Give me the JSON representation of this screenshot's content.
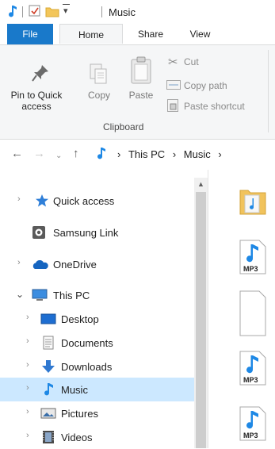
{
  "window": {
    "title": "Music"
  },
  "tabs": {
    "file": "File",
    "home": "Home",
    "share": "Share",
    "view": "View"
  },
  "ribbon": {
    "pin_label_1": "Pin to Quick",
    "pin_label_2": "access",
    "copy_label": "Copy",
    "paste_label": "Paste",
    "cut_label": "Cut",
    "copy_path_label": "Copy path",
    "paste_shortcut_label": "Paste shortcut",
    "group_label": "Clipboard"
  },
  "address": {
    "crumb_sep": "›",
    "crumbs": [
      "This PC",
      "Music"
    ]
  },
  "nav": {
    "items": [
      {
        "label": "Quick access",
        "icon": "star-icon"
      },
      {
        "label": "Samsung Link",
        "icon": "samsung-link-icon"
      },
      {
        "label": "OneDrive",
        "icon": "cloud-icon"
      },
      {
        "label": "This PC",
        "icon": "computer-icon"
      },
      {
        "label": "Desktop",
        "icon": "desktop-icon"
      },
      {
        "label": "Documents",
        "icon": "documents-icon"
      },
      {
        "label": "Downloads",
        "icon": "download-icon"
      },
      {
        "label": "Music",
        "icon": "music-note-icon",
        "selected": true
      },
      {
        "label": "Pictures",
        "icon": "pictures-icon"
      },
      {
        "label": "Videos",
        "icon": "videos-icon"
      }
    ]
  },
  "content": {
    "mp3_badge": "MP3"
  },
  "colors": {
    "accent": "#1979ca",
    "selection": "#cce8ff",
    "ribbon_bg": "#f5f6f7"
  }
}
